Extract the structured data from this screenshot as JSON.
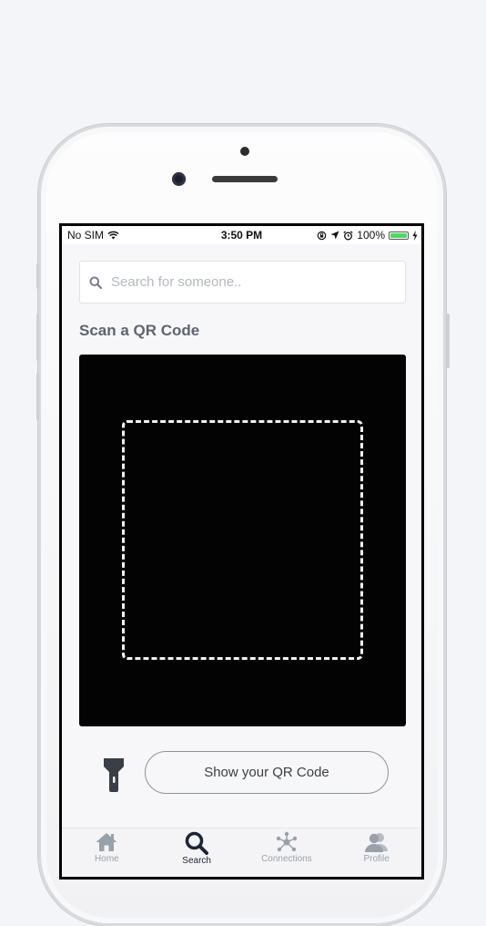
{
  "status_bar": {
    "carrier": "No SIM",
    "time": "3:50 PM",
    "battery": "100%",
    "battery_level": 1.0
  },
  "search": {
    "placeholder": "Search for someone.."
  },
  "scanner": {
    "title": "Scan a QR Code"
  },
  "actions": {
    "show_qr_label": "Show your QR Code"
  },
  "tabs": [
    {
      "label": "Home",
      "icon": "home-icon",
      "active": false
    },
    {
      "label": "Search",
      "icon": "search-icon",
      "active": true
    },
    {
      "label": "Connections",
      "icon": "connections-icon",
      "active": false
    },
    {
      "label": "Profile",
      "icon": "profile-icon",
      "active": false
    }
  ],
  "colors": {
    "battery": "#4cd964",
    "active_tab": "#1d2433",
    "inactive_tab": "#9aa0aa"
  }
}
